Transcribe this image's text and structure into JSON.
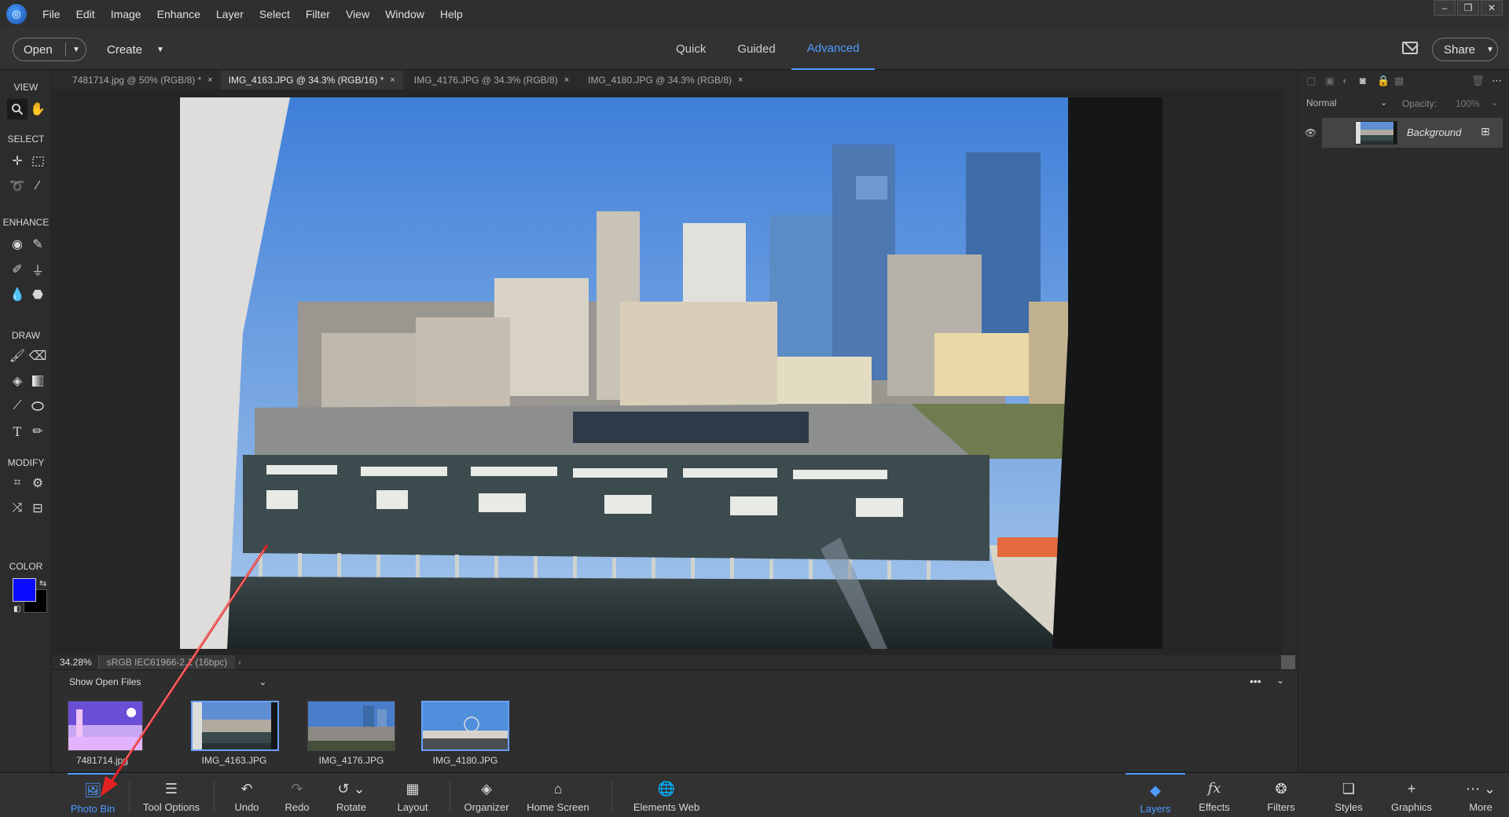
{
  "menubar": {
    "items": [
      "File",
      "Edit",
      "Image",
      "Enhance",
      "Layer",
      "Select",
      "Filter",
      "View",
      "Window",
      "Help"
    ],
    "window_controls": {
      "minimize": "–",
      "restore": "❐",
      "close": "✕"
    }
  },
  "modebar": {
    "open_label": "Open",
    "create_label": "Create",
    "tabs": [
      {
        "label": "Quick",
        "active": false
      },
      {
        "label": "Guided",
        "active": false
      },
      {
        "label": "Advanced",
        "active": true
      }
    ],
    "share_label": "Share"
  },
  "toolbar": {
    "sections": {
      "view": "VIEW",
      "select": "SELECT",
      "enhance": "ENHANCE",
      "draw": "DRAW",
      "modify": "MODIFY",
      "color": "COLOR"
    },
    "foreground_color": "#0a0aff",
    "background_color": "#000000"
  },
  "doc_tabs": [
    {
      "label": "7481714.jpg @ 50% (RGB/8) *",
      "close": "×",
      "active": false
    },
    {
      "label": "IMG_4163.JPG @ 34.3% (RGB/16) *",
      "close": "×",
      "active": true
    },
    {
      "label": "IMG_4176.JPG @ 34.3% (RGB/8)",
      "close": "×",
      "active": false
    },
    {
      "label": "IMG_4180.JPG @ 34.3% (RGB/8)",
      "close": "×",
      "active": false
    }
  ],
  "status": {
    "zoom": "34.28%",
    "profile": "sRGB IEC61966-2.1 (16bpc)",
    "arrow": "›"
  },
  "photobin": {
    "header": "Show Open Files",
    "thumbnails": [
      {
        "label": "7481714.jpg",
        "selected": false
      },
      {
        "label": "IMG_4163.JPG",
        "selected": true
      },
      {
        "label": "IMG_4176.JPG",
        "selected": false
      },
      {
        "label": "IMG_4180.JPG",
        "selected": true
      }
    ]
  },
  "bottombar": {
    "left": [
      {
        "label": "Photo Bin",
        "icon": "photo-bin-icon",
        "active": true
      },
      {
        "label": "Tool Options",
        "icon": "tool-options-icon"
      },
      {
        "label": "Undo",
        "icon": "undo-icon"
      },
      {
        "label": "Redo",
        "icon": "redo-icon"
      },
      {
        "label": "Rotate",
        "icon": "rotate-icon"
      },
      {
        "label": "Layout",
        "icon": "layout-icon"
      },
      {
        "label": "Organizer",
        "icon": "organizer-icon"
      },
      {
        "label": "Home Screen",
        "icon": "home-icon"
      },
      {
        "label": "Elements Web",
        "icon": "globe-icon"
      }
    ],
    "right": [
      {
        "label": "Layers",
        "icon": "layers-icon",
        "active": true
      },
      {
        "label": "Effects",
        "icon": "fx-icon"
      },
      {
        "label": "Filters",
        "icon": "filters-icon"
      },
      {
        "label": "Styles",
        "icon": "styles-icon"
      },
      {
        "label": "Graphics",
        "icon": "plus-icon"
      },
      {
        "label": "More",
        "icon": "more-icon"
      }
    ]
  },
  "layers": {
    "blend_mode": "Normal",
    "opacity_label": "Opacity:",
    "opacity_value": "100%",
    "items": [
      {
        "name": "Background",
        "visible": true
      }
    ]
  },
  "colors": {
    "accent": "#4e9cff",
    "annotation": "#e32222"
  }
}
